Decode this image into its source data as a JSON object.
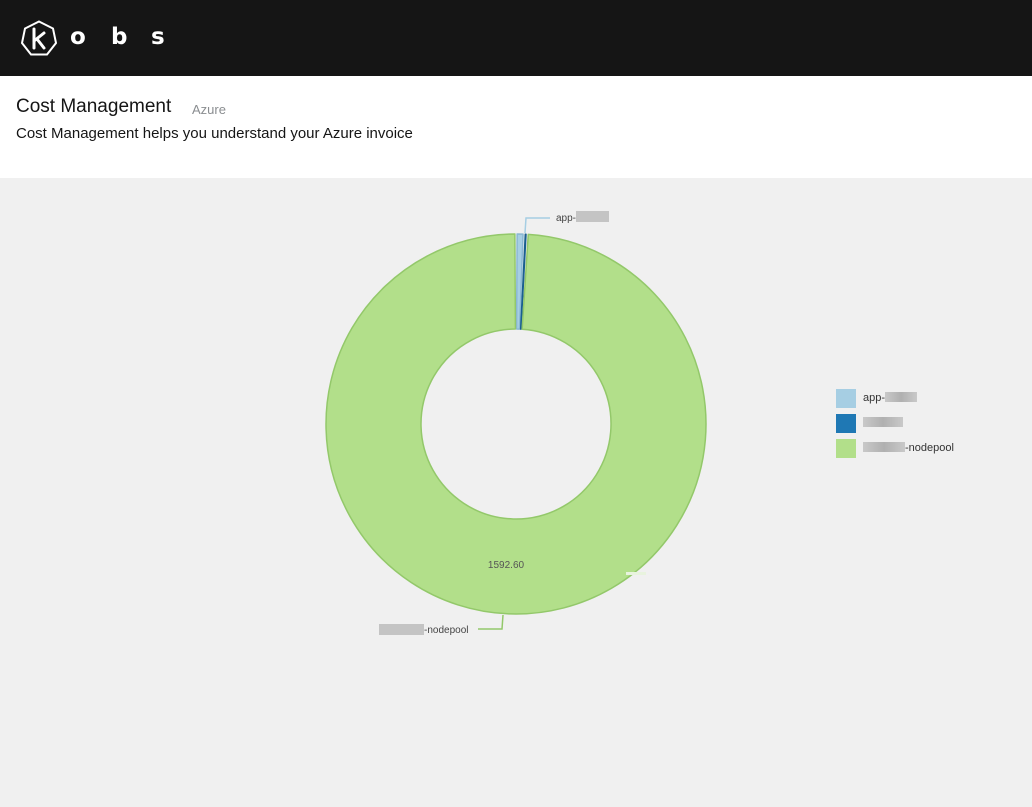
{
  "masthead": {
    "brand_letters": [
      "o",
      "b",
      "s"
    ],
    "logo_icon": "kubernetes-k-logo-icon",
    "background": "#151515"
  },
  "header": {
    "title": "Cost Management",
    "provider_tag": "Azure",
    "description": "Cost Management helps you understand your Azure invoice"
  },
  "chart_data": {
    "type": "pie",
    "variant": "donut",
    "title": "",
    "categories": [
      "app-",
      "",
      "-nodepool"
    ],
    "values": [
      11,
      4,
      1592.6
    ],
    "colors": [
      "#a6cee3",
      "#1f78b4",
      "#b2df8a"
    ],
    "center_label": "",
    "data_labels": [
      "",
      "",
      "1592.60"
    ],
    "legend_position": "right",
    "legend": [
      "app-",
      "",
      "-nodepool"
    ]
  }
}
